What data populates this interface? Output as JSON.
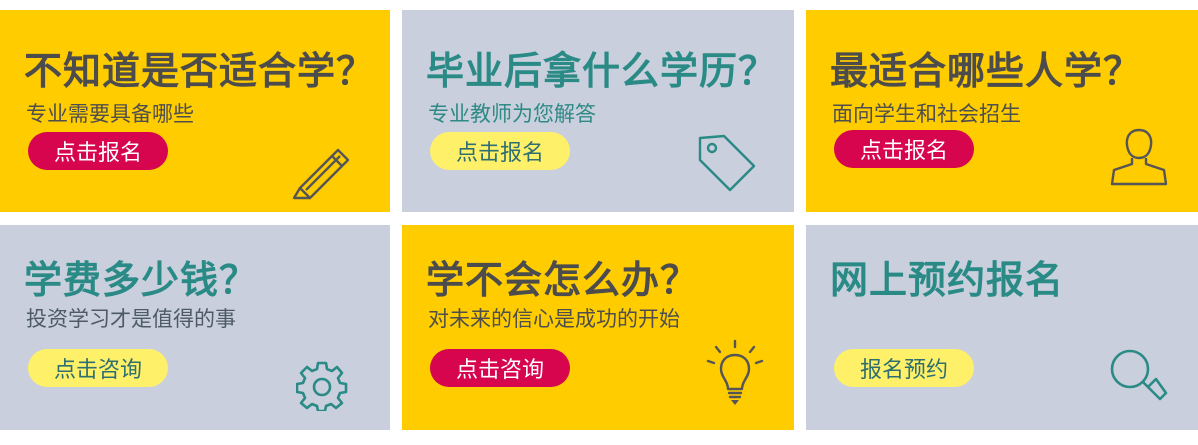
{
  "cards": [
    {
      "title": "不知道是否适合学？",
      "subtitle": "专业需要具备哪些",
      "button": "点击报名",
      "icon": "pencil-icon"
    },
    {
      "title": "毕业后拿什么学历？",
      "subtitle": "专业教师为您解答",
      "button": "点击报名",
      "icon": "tag-icon"
    },
    {
      "title": "最适合哪些人学？",
      "subtitle": "面向学生和社会招生",
      "button": "点击报名",
      "icon": "person-icon"
    },
    {
      "title": "学费多少钱？",
      "subtitle": "投资学习才是值得的事",
      "button": "点击咨询",
      "icon": "gear-icon"
    },
    {
      "title": "学不会怎么办？",
      "subtitle": "对未来的信心是成功的开始",
      "button": "点击咨询",
      "icon": "lightbulb-icon"
    },
    {
      "title": "网上预约报名",
      "subtitle": "",
      "button": "报名预约",
      "icon": "magnifier-icon"
    }
  ],
  "colors": {
    "yellow": "#ffcc00",
    "gray": "#c9cfdc",
    "red_button": "#d6054d",
    "lemon_button": "#fff06a",
    "teal": "#2a8a86",
    "dark_text": "#4c4c4c"
  }
}
